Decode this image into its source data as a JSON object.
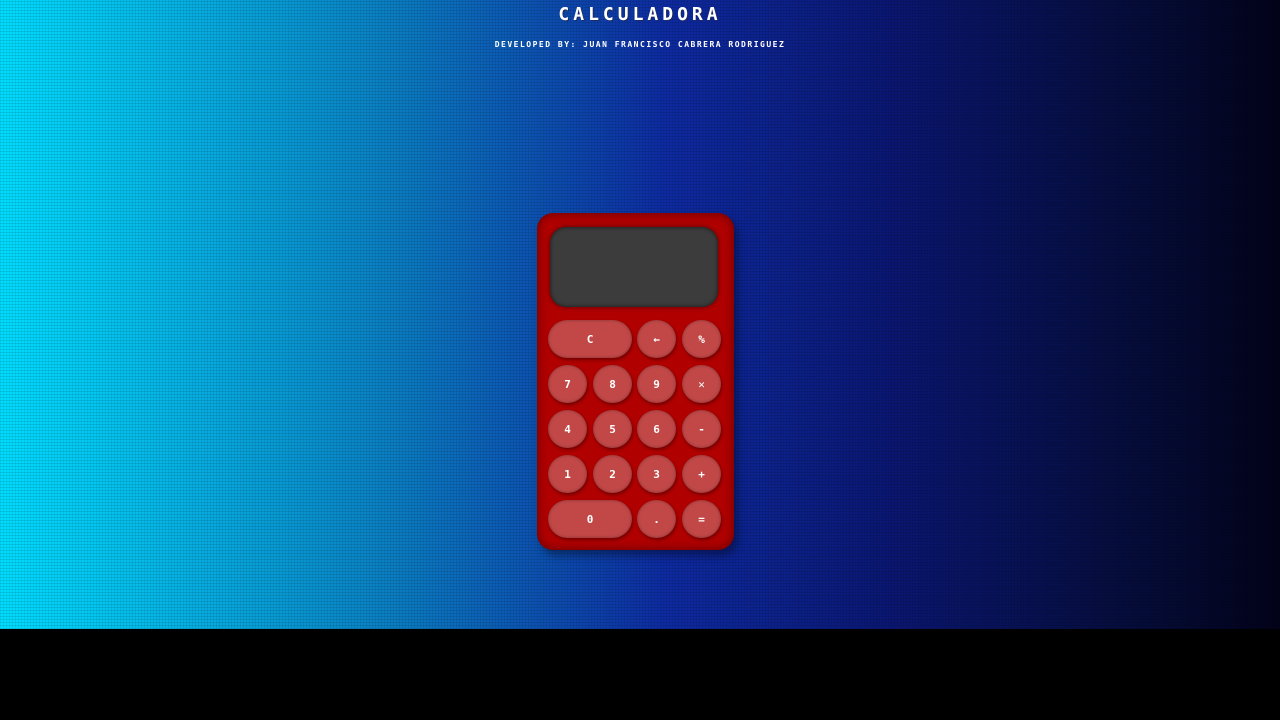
{
  "header": {
    "title": "CALCULADORA",
    "subtitle": "DEVELOPED BY: JUAN FRANCISCO CABRERA RODRIGUEZ"
  },
  "calculator": {
    "display": "",
    "keys": {
      "clear": "C",
      "backspace": "←",
      "percent": "%",
      "seven": "7",
      "eight": "8",
      "nine": "9",
      "multiply": "✕",
      "four": "4",
      "five": "5",
      "six": "6",
      "subtract": "-",
      "one": "1",
      "two": "2",
      "three": "3",
      "add": "+",
      "zero": "0",
      "decimal": ".",
      "equals": "="
    }
  },
  "colors": {
    "body": "#b00000",
    "key": "#c24848",
    "screen": "#3c3c3c",
    "gradient_start": "#00dcff",
    "gradient_end": "#02021a"
  }
}
